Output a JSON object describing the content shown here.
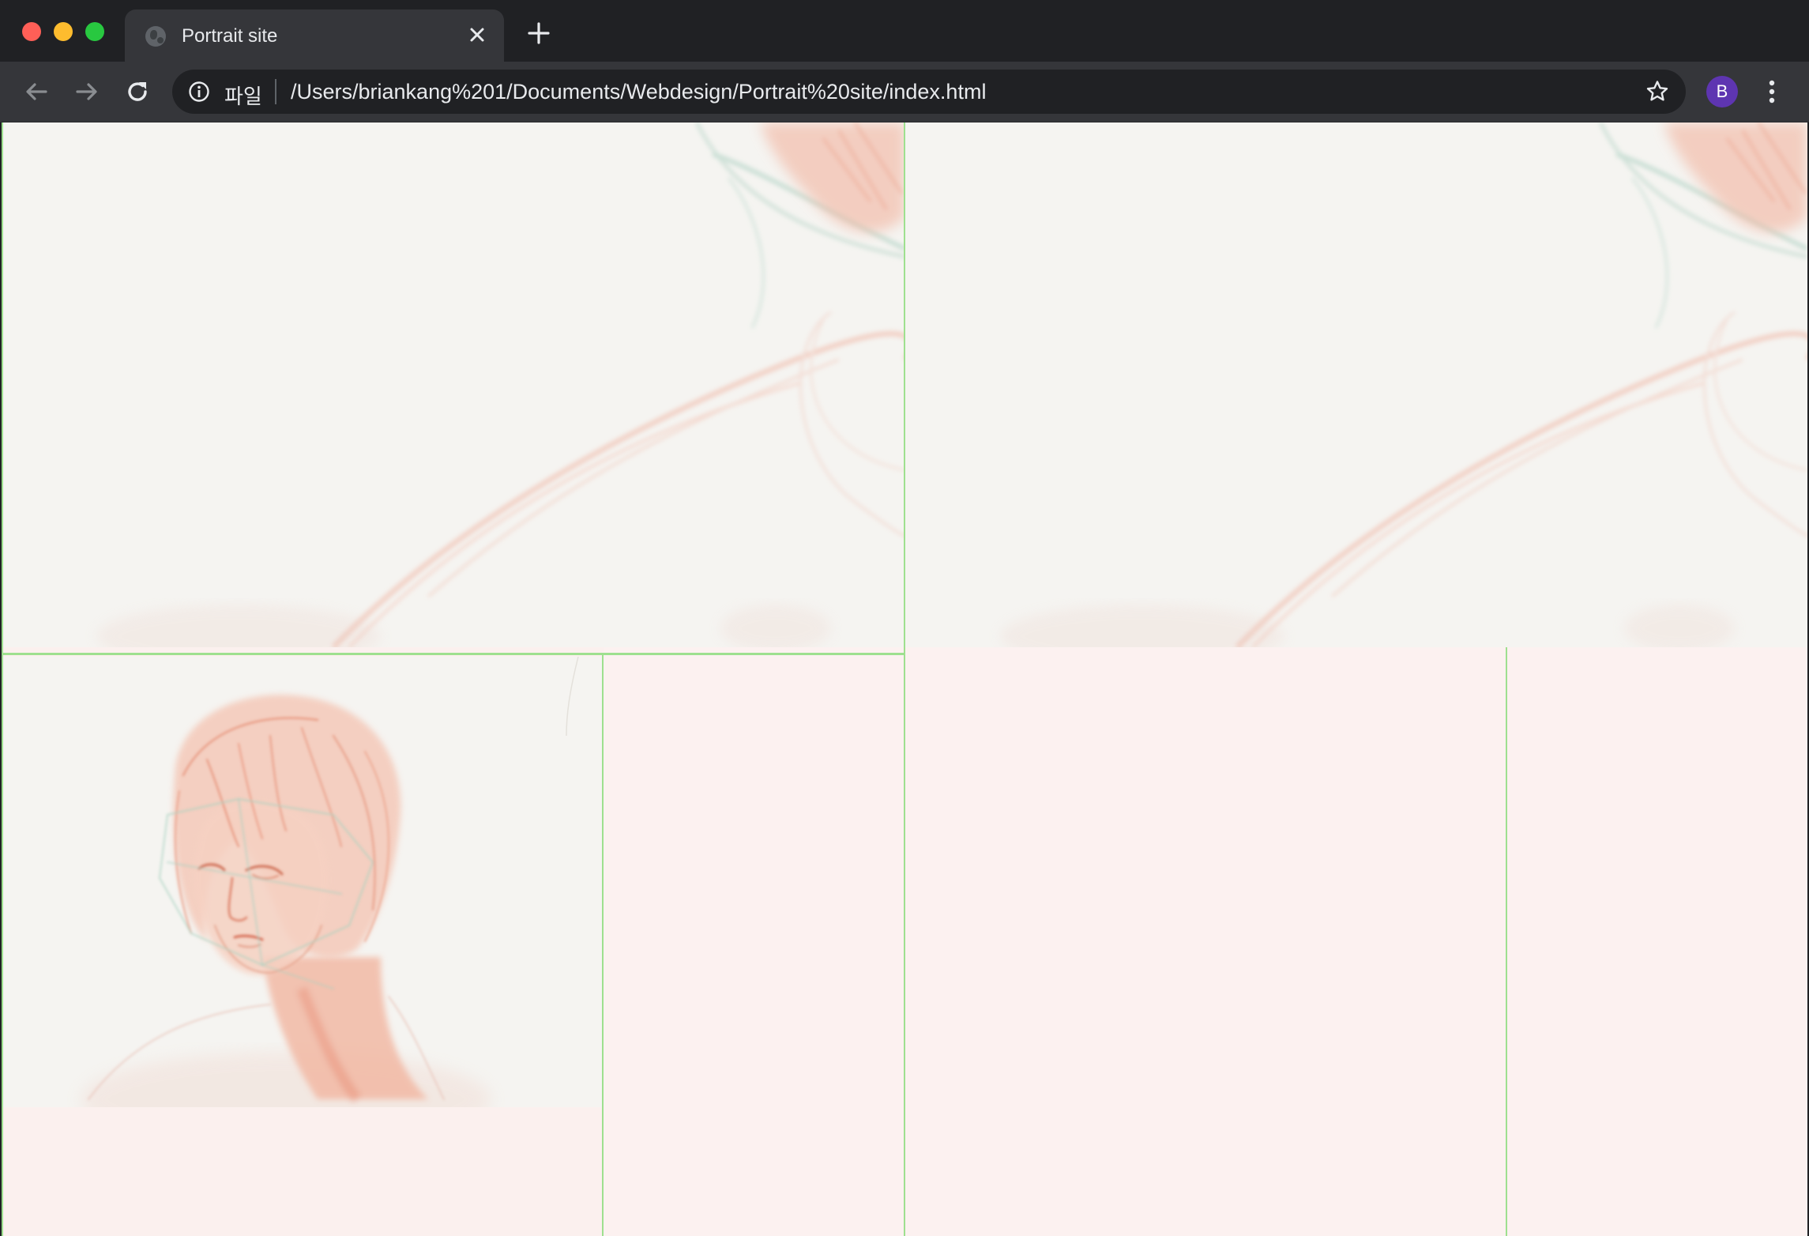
{
  "browser": {
    "tab": {
      "title": "Portrait site",
      "favicon": "globe-icon",
      "close": "×"
    },
    "new_tab": "+",
    "toolbar": {
      "back_icon": "back-arrow-icon",
      "forward_icon": "forward-arrow-icon",
      "reload_icon": "reload-icon",
      "omnibox": {
        "info_icon": "info-icon",
        "scheme_label": "파일",
        "url": "/Users/briankang%201/Documents/Webdesign/Portrait%20site/index.html"
      },
      "bookmark_icon": "star-icon",
      "profile_initial": "B",
      "menu_icon": "vertical-dots-icon"
    }
  },
  "page": {
    "background_color": "#fbf0ee",
    "border_color": "#9ee08f",
    "panels": [
      {
        "name": "top-left-sketch-panel",
        "content": "sketch of hair and shoulder line"
      },
      {
        "name": "top-right-sketch-panel",
        "content": "sketch of hair and shoulder line"
      },
      {
        "name": "portrait-panel",
        "content": "pencil portrait of woman with bob haircut"
      }
    ]
  }
}
